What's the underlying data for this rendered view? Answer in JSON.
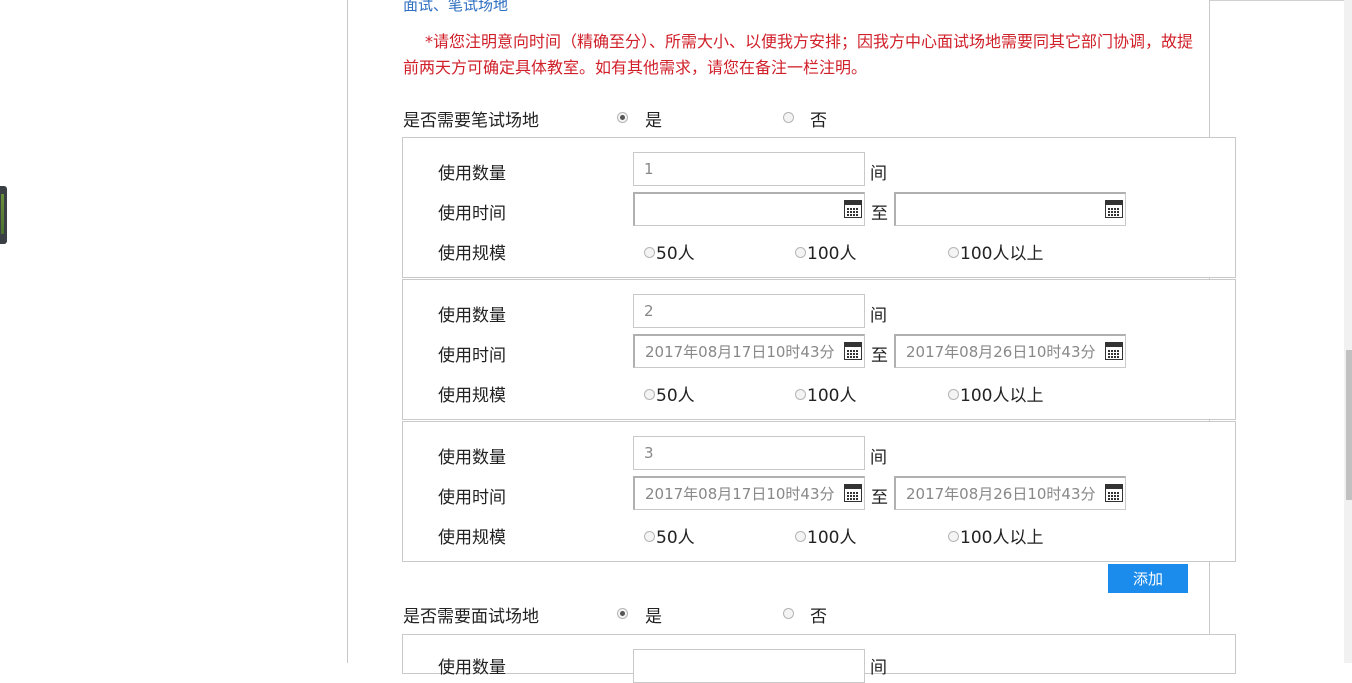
{
  "section_title": "面试、笔试场地",
  "notice": "*请您注明意向时间（精确至分）、所需大小、以便我方安排；因我方中心面试场地需要同其它部门协调，故提前两天方可确定具体教室。如有其他需求，请您在备注一栏注明。",
  "written": {
    "question": "是否需要笔试场地",
    "yes": "是",
    "no": "否",
    "selected": "是"
  },
  "interview": {
    "question": "是否需要面试场地",
    "yes": "是",
    "no": "否",
    "selected": "是"
  },
  "labels": {
    "quantity": "使用数量",
    "time": "使用时间",
    "scale": "使用规模",
    "room_unit": "间",
    "to": "至"
  },
  "scale_options": [
    "50人",
    "100人",
    "100人以上"
  ],
  "groups": [
    {
      "quantity": "1",
      "start": "",
      "end": ""
    },
    {
      "quantity": "2",
      "start": "2017年08月17日10时43分",
      "end": "2017年08月26日10时43分"
    },
    {
      "quantity": "3",
      "start": "2017年08月17日10时43分",
      "end": "2017年08月26日10时43分"
    }
  ],
  "add_button": "添加",
  "colors": {
    "notice": "#d0202a",
    "title": "#2d6fc0",
    "button": "#1b8bec"
  }
}
